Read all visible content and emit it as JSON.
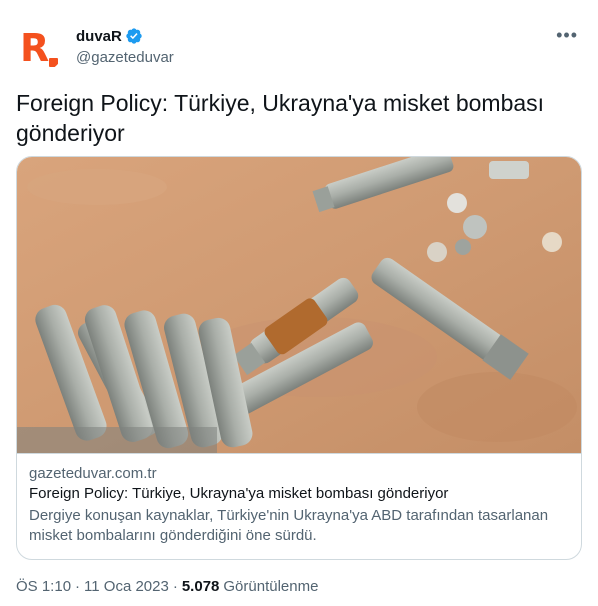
{
  "author": {
    "display_name": "duvaR",
    "handle": "@gazeteduvar",
    "avatar_letter": "R",
    "brand_color": "#f4511e",
    "verified_color": "#1d9bf0"
  },
  "menu_icon": "more-horizontal-icon",
  "tweet": {
    "text": "Foreign Policy: Türkiye, Ukrayna'ya misket bombası gönderiyor"
  },
  "card": {
    "image_description_icon": "photo-cluster-munitions",
    "domain": "gazeteduvar.com.tr",
    "title": "Foreign Policy: Türkiye, Ukrayna'ya misket bombası gönderiyor",
    "description": "Dergiye konuşan kaynaklar, Türkiye'nin Ukrayna'ya ABD tarafından tasarlanan misket bombalarını gönderdiğini öne sürdü."
  },
  "meta": {
    "time": "ÖS 1:10",
    "separator": "·",
    "date": "11 Oca 2023",
    "views_count": "5.078",
    "views_label": "Görüntülenme"
  }
}
